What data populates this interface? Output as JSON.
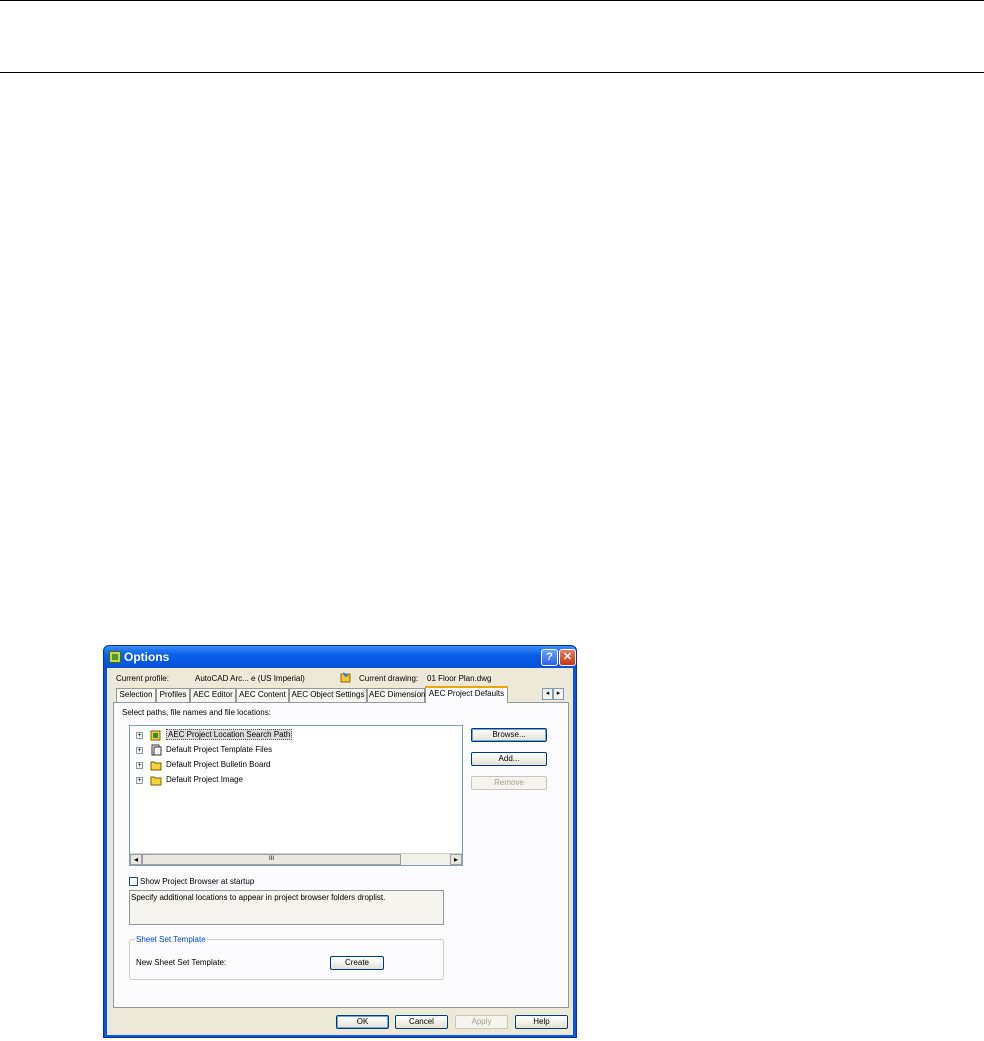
{
  "window": {
    "title": "Options",
    "help_btn": "?",
    "close_btn": "✕"
  },
  "profile": {
    "current_profile_label": "Current profile:",
    "current_profile_value": "AutoCAD Arc... e (US Imperial)",
    "current_drawing_label": "Current drawing:",
    "current_drawing_value": "01 Floor Plan.dwg"
  },
  "tabs": [
    {
      "label": "Selection"
    },
    {
      "label": "Profiles"
    },
    {
      "label": "AEC Editor"
    },
    {
      "label": "AEC Content"
    },
    {
      "label": "AEC Object Settings"
    },
    {
      "label": "AEC Dimension"
    },
    {
      "label": "AEC Project Defaults",
      "active": true
    }
  ],
  "tab_scroll": {
    "left": "◂",
    "right": "▸"
  },
  "panel": {
    "select_label": "Select paths, file names and file locations:",
    "tree_items": [
      {
        "label": "AEC Project Location Search Path",
        "icon": "search-path-folder-icon",
        "selected": true
      },
      {
        "label": "Default Project Template Files",
        "icon": "document-icon"
      },
      {
        "label": "Default Project Bulletin Board",
        "icon": "folder-icon"
      },
      {
        "label": "Default Project Image",
        "icon": "folder-icon"
      }
    ],
    "expander": "+",
    "hscroll": {
      "left": "◂",
      "right": "▸",
      "grip": "III"
    },
    "buttons": {
      "browse": "Browse...",
      "add": "Add...",
      "remove": "Remove"
    },
    "show_browser_label": "Show Project Browser at startup",
    "show_browser_checked": false,
    "description": "Specify additional locations to appear in project browser folders droplist.",
    "sheet_set": {
      "legend": "Sheet Set Template",
      "template_label": "New Sheet Set Template:",
      "create_button": "Create"
    }
  },
  "footer": {
    "ok": "OK",
    "cancel": "Cancel",
    "apply": "Apply",
    "help": "Help"
  },
  "colors": {
    "titlebar": "#0a5fe8",
    "dialog_face": "#ece9d8",
    "active_tab_accent": "#f2a400"
  }
}
